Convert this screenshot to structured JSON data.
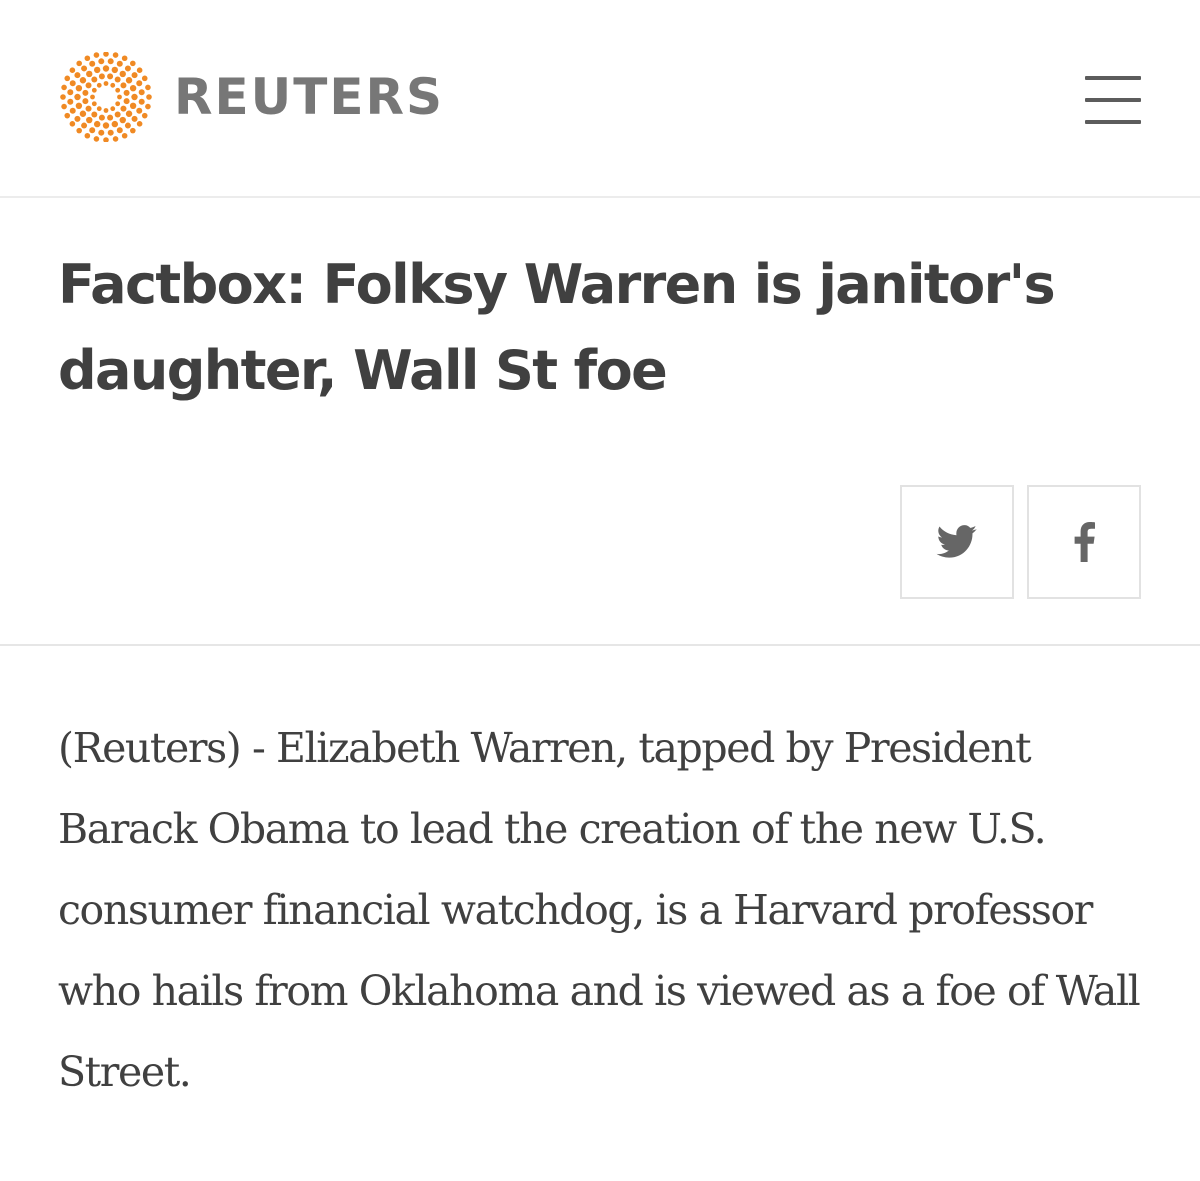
{
  "header": {
    "brand_name": "REUTERS",
    "logo_icon": "reuters-dot-sphere-icon",
    "menu_icon": "hamburger-menu-icon",
    "brand_color": "#f08a24"
  },
  "article": {
    "headline": "Factbox: Folksy Warren is janitor's daughter, Wall St foe",
    "body": "(Reuters) - Elizabeth Warren, tapped by President Barack Obama to lead the creation of the new U.S. consumer financial watchdog, is a Harvard professor who hails from Oklahoma and is viewed as a foe of Wall Street."
  },
  "share": {
    "twitter_icon": "twitter-bird-icon",
    "facebook_icon": "facebook-f-icon"
  }
}
